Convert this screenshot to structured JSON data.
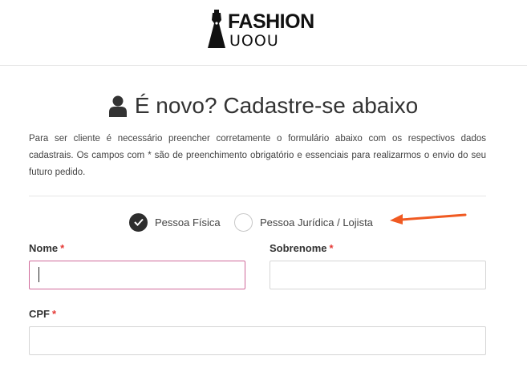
{
  "header": {
    "logo_word": "FASHION",
    "logo_sub": "UOOU"
  },
  "form": {
    "title": "É novo? Cadastre-se abaixo",
    "description": "Para ser cliente é necessário preencher corretamente o formulário abaixo com os respectivos dados cadastrais. Os campos com * são de preenchimento obrigatório e essenciais para realizarmos o envio do seu futuro pedido.",
    "person_type": {
      "options": [
        {
          "label": "Pessoa Física",
          "checked": true
        },
        {
          "label": "Pessoa Jurídica / Lojista",
          "checked": false
        }
      ]
    },
    "fields": {
      "nome": {
        "label": "Nome",
        "required_mark": "*",
        "value": ""
      },
      "sobrenome": {
        "label": "Sobrenome",
        "required_mark": "*",
        "value": ""
      },
      "cpf": {
        "label": "CPF",
        "required_mark": "*",
        "value": ""
      }
    }
  },
  "annotation": {
    "arrow_color": "#f05a22"
  },
  "colors": {
    "accent_focus": "#d06a9a",
    "required": "#e53935",
    "radio_checked": "#2e2e2e"
  }
}
